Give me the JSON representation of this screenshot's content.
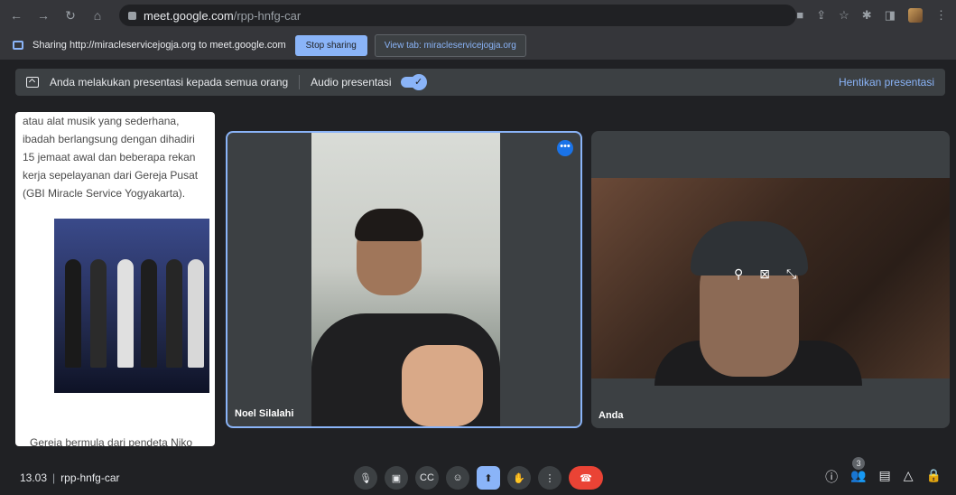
{
  "browser": {
    "url_host": "meet.google.com",
    "url_path": "/rpp-hnfg-car"
  },
  "share_bar": {
    "text": "Sharing http://miracleservicejogja.org to meet.google.com",
    "stop_label": "Stop sharing",
    "view_tab_label": "View tab: miracleservicejogja.org"
  },
  "presentation_bar": {
    "message": "Anda melakukan presentasi kepada semua orang",
    "audio_label": "Audio presentasi",
    "stop_label": "Hentikan presentasi"
  },
  "slide": {
    "text_top": "atau alat musik yang sederhana, ibadah berlangsung dengan dihadiri 15 jemaat awal dan beberapa rekan kerja sepelayanan dari Gereja Pusat (GBI Miracle Service Yogyakarta).",
    "text_bottom": "Gereja bermula dari pendeta Niko"
  },
  "participants": [
    {
      "name": "Noel Silalahi"
    },
    {
      "name": "Anda"
    }
  ],
  "meeting": {
    "time": "13.03",
    "code": "rpp-hnfg-car",
    "people_count": "3"
  },
  "colors": {
    "accent": "#8ab4f8",
    "end_call": "#ea4335",
    "background": "#202124"
  }
}
